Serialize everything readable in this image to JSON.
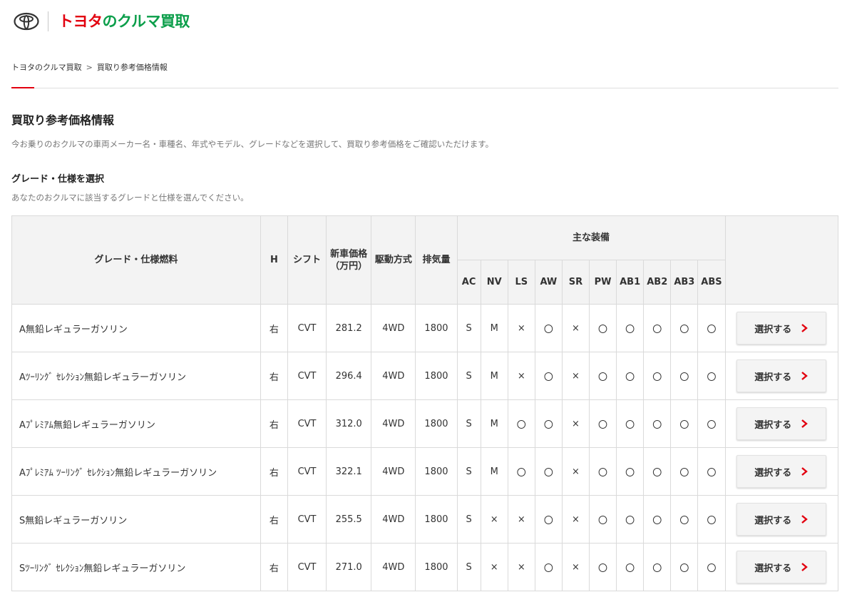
{
  "brand": {
    "logo_alt": "TOYOTA",
    "service_name_part1": "トヨタ",
    "service_name_part2": "の",
    "service_name_part3": "クルマ買取",
    "colors": {
      "red": "#e2000f",
      "green": "#0b9e4a"
    }
  },
  "breadcrumb": {
    "home": "トヨタのクルマ買取",
    "separator": ">",
    "current": "買取り参考価格情報"
  },
  "page": {
    "title": "買取り参考価格情報",
    "description": "今お乗りのおクルマの車両メーカー名・車種名、年式やモデル、グレードなどを選択して、買取り参考価格をご確認いただけます。"
  },
  "section": {
    "title": "グレード・仕様を選択",
    "description": "あなたのおクルマに該当するグレードと仕様を選んでください。"
  },
  "table": {
    "headers": {
      "grade": "グレード・仕様燃料",
      "handle": "H",
      "shift": "シフト",
      "price_line1": "新車価格",
      "price_line2": "（万円）",
      "drive": "駆動方式",
      "displacement": "排気量",
      "equipment": "主な装備",
      "equipment_cols": [
        "AC",
        "NV",
        "LS",
        "AW",
        "SR",
        "PW",
        "AB1",
        "AB2",
        "AB3",
        "ABS"
      ]
    },
    "select_label": "選択する",
    "rows": [
      {
        "name": "A無鉛レギュラーガソリン",
        "handle": "右",
        "shift": "CVT",
        "price": "281.2",
        "drive": "4WD",
        "displacement": "1800",
        "equipment": [
          "S",
          "M",
          "×",
          "〇",
          "×",
          "〇",
          "〇",
          "〇",
          "〇",
          "〇"
        ]
      },
      {
        "name": "Aﾂｰﾘﾝｸﾞ ｾﾚｸｼｮﾝ無鉛レギュラーガソリン",
        "handle": "右",
        "shift": "CVT",
        "price": "296.4",
        "drive": "4WD",
        "displacement": "1800",
        "equipment": [
          "S",
          "M",
          "×",
          "〇",
          "×",
          "〇",
          "〇",
          "〇",
          "〇",
          "〇"
        ]
      },
      {
        "name": "Aﾌﾟﾚﾐｱﾑ無鉛レギュラーガソリン",
        "handle": "右",
        "shift": "CVT",
        "price": "312.0",
        "drive": "4WD",
        "displacement": "1800",
        "equipment": [
          "S",
          "M",
          "〇",
          "〇",
          "×",
          "〇",
          "〇",
          "〇",
          "〇",
          "〇"
        ]
      },
      {
        "name": "Aﾌﾟﾚﾐｱﾑ ﾂｰﾘﾝｸﾞ ｾﾚｸｼｮﾝ無鉛レギュラーガソリン",
        "handle": "右",
        "shift": "CVT",
        "price": "322.1",
        "drive": "4WD",
        "displacement": "1800",
        "equipment": [
          "S",
          "M",
          "〇",
          "〇",
          "×",
          "〇",
          "〇",
          "〇",
          "〇",
          "〇"
        ]
      },
      {
        "name": "S無鉛レギュラーガソリン",
        "handle": "右",
        "shift": "CVT",
        "price": "255.5",
        "drive": "4WD",
        "displacement": "1800",
        "equipment": [
          "S",
          "×",
          "×",
          "〇",
          "×",
          "〇",
          "〇",
          "〇",
          "〇",
          "〇"
        ]
      },
      {
        "name": "Sﾂｰﾘﾝｸﾞ ｾﾚｸｼｮﾝ無鉛レギュラーガソリン",
        "handle": "右",
        "shift": "CVT",
        "price": "271.0",
        "drive": "4WD",
        "displacement": "1800",
        "equipment": [
          "S",
          "×",
          "×",
          "〇",
          "×",
          "〇",
          "〇",
          "〇",
          "〇",
          "〇"
        ]
      }
    ]
  }
}
